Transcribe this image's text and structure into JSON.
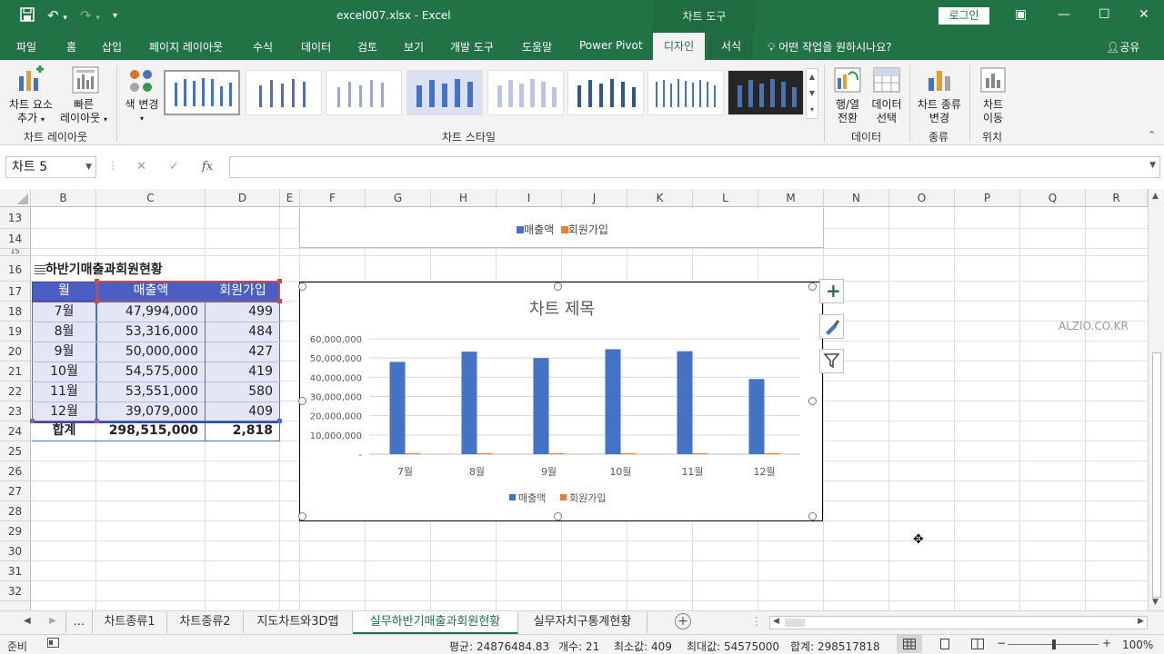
{
  "titlebar": {
    "title": "excel007.xlsx  -  Excel",
    "chart_tools": "차트 도구",
    "login": "로그인"
  },
  "tabs": [
    "파일",
    "홈",
    "삽입",
    "페이지 레이아웃",
    "수식",
    "데이터",
    "검토",
    "보기",
    "개발 도구",
    "도움말",
    "Power Pivot",
    "디자인",
    "서식"
  ],
  "tell_me": "어떤 작업을 원하시나요?",
  "share": "공유",
  "ribbon": {
    "add_element_1": "차트 요소",
    "add_element_2": "추가",
    "quick_layout_1": "빠른",
    "quick_layout_2": "레이아웃",
    "change_color": "색 변경",
    "group_layout": "차트 레이아웃",
    "group_styles": "차트 스타일",
    "switch_row_col_1": "행/열",
    "switch_row_col_2": "전환",
    "select_data_1": "데이터",
    "select_data_2": "선택",
    "group_data": "데이터",
    "change_type_1": "차트 종류",
    "change_type_2": "변경",
    "group_type": "종류",
    "move_chart_1": "차트",
    "move_chart_2": "이동",
    "group_location": "위치"
  },
  "formula": {
    "namebox": "차트 5",
    "cancel": "✕",
    "enter": "✓",
    "fx": "fx",
    "value": ""
  },
  "columns": [
    "B",
    "C",
    "D",
    "E",
    "F",
    "G",
    "H",
    "I",
    "J",
    "K",
    "L",
    "M",
    "N",
    "O",
    "P",
    "Q",
    "R"
  ],
  "rows": [
    "13",
    "14",
    "15",
    "16",
    "17",
    "18",
    "19",
    "20",
    "21",
    "22",
    "23",
    "24",
    "25",
    "26",
    "27",
    "28",
    "29",
    "30",
    "31",
    "32"
  ],
  "table": {
    "title": "하반기매출과회원현황",
    "headers": [
      "월",
      "매출액",
      "회원가입"
    ],
    "data": [
      [
        "7월",
        "47,994,000",
        "499"
      ],
      [
        "8월",
        "53,316,000",
        "484"
      ],
      [
        "9월",
        "50,000,000",
        "427"
      ],
      [
        "10월",
        "54,575,000",
        "419"
      ],
      [
        "11월",
        "53,551,000",
        "580"
      ],
      [
        "12월",
        "39,079,000",
        "409"
      ]
    ],
    "total": [
      "합계",
      "298,515,000",
      "2,818"
    ]
  },
  "watermark": "ALZIO.CO.KR",
  "chart_data": {
    "type": "bar",
    "title": "차트 제목",
    "categories": [
      "7월",
      "8월",
      "9월",
      "10월",
      "11월",
      "12월"
    ],
    "series": [
      {
        "name": "매출액",
        "values": [
          47994000,
          53316000,
          50000000,
          54575000,
          53551000,
          39079000
        ],
        "color": "#4472c4"
      },
      {
        "name": "회원가입",
        "values": [
          499,
          484,
          427,
          419,
          580,
          409
        ],
        "color": "#ed7d31"
      }
    ],
    "ylim": [
      0,
      60000000
    ],
    "yticks": [
      "60,000,000",
      "50,000,000",
      "40,000,000",
      "30,000,000",
      "20,000,000",
      "10,000,000",
      "-"
    ],
    "legend": "bottom",
    "grid": true
  },
  "top_chart_legend": [
    "매출액",
    "회원가입"
  ],
  "sheets": [
    "...",
    "차트종류1",
    "차트종류2",
    "지도차트와3D맵",
    "실무하반기매출과회원현황",
    "실무자치구통계현황"
  ],
  "status": {
    "ready": "준비",
    "average": "평균: 24876484.83",
    "count": "개수: 21",
    "min": "최소값: 409",
    "max": "최대값: 54575000",
    "sum": "합계: 298517818",
    "zoom": "100%"
  }
}
